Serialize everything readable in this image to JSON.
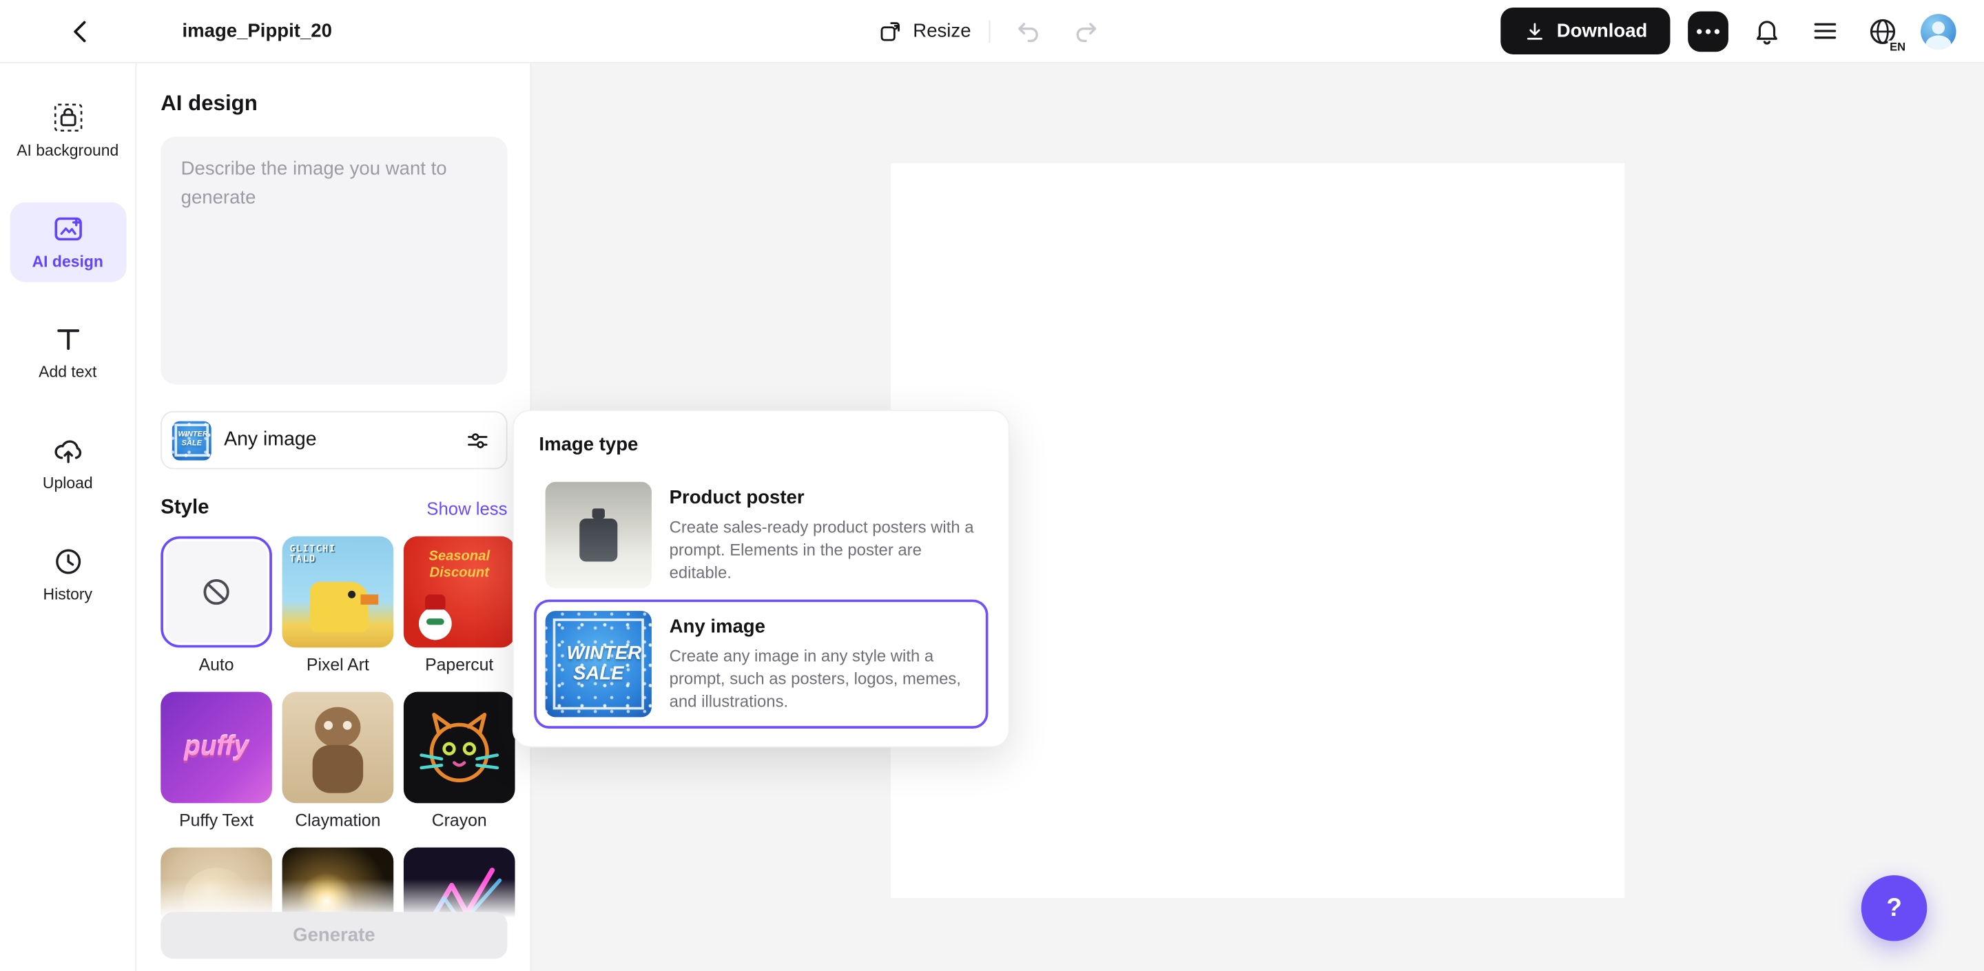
{
  "topbar": {
    "title": "image_Pippit_20",
    "resize_label": "Resize",
    "download_label": "Download",
    "language": "EN"
  },
  "sidebar": {
    "items": [
      {
        "label": "AI background"
      },
      {
        "label": "AI design"
      },
      {
        "label": "Add text"
      },
      {
        "label": "Upload"
      },
      {
        "label": "History"
      }
    ]
  },
  "panel": {
    "title": "AI design",
    "prompt_placeholder": "Describe the image you want to generate",
    "image_type_selector": {
      "value": "Any image",
      "thumb_text": "WINTER SALE"
    },
    "style_section": {
      "title": "Style",
      "toggle_label": "Show less"
    },
    "styles": [
      {
        "label": "Auto"
      },
      {
        "label": "Pixel Art",
        "thumb_text": "GLITCHI TALD"
      },
      {
        "label": "Papercut",
        "thumb_text": "Seasonal Discount"
      },
      {
        "label": "Puffy Text",
        "thumb_text": "puffy"
      },
      {
        "label": "Claymation"
      },
      {
        "label": "Crayon"
      }
    ],
    "generate_label": "Generate"
  },
  "popover": {
    "title": "Image type",
    "options": [
      {
        "title": "Product poster",
        "description": "Create sales-ready product posters with a prompt. Elements in the poster are editable."
      },
      {
        "title": "Any image",
        "description": "Create any image in any style with a prompt, such as posters, logos, memes, and illustrations.",
        "thumb_text": "WINTER SALE"
      }
    ]
  },
  "help": {
    "label": "?"
  },
  "colors": {
    "accent": "#6a4bff",
    "accent_light": "#ecebff",
    "download_bg": "#141417",
    "canvas_bg": "#f4f4f5",
    "winter_blue": "#2f86dd"
  }
}
